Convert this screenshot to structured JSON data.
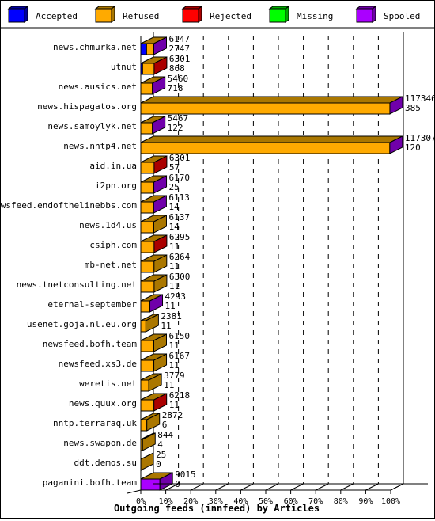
{
  "chart_data": {
    "type": "bar",
    "orientation": "horizontal",
    "stacked": true,
    "three_d": true,
    "title": "Outgoing feeds (innfeed) by Articles",
    "xlabel": "Outgoing feeds (innfeed) by Articles",
    "ylabel": "",
    "xlim_percent": [
      0,
      100
    ],
    "x_ticks": [
      "0%",
      "10%",
      "20%",
      "30%",
      "40%",
      "50%",
      "60%",
      "70%",
      "80%",
      "90%",
      "100%"
    ],
    "grid": "vertical dashed",
    "legend_position": "top",
    "legend": [
      {
        "name": "Accepted",
        "color": "#0000ff",
        "shade": "#0000a0"
      },
      {
        "name": "Refused",
        "color": "#ffaa00",
        "shade": "#aa7700"
      },
      {
        "name": "Rejected",
        "color": "#ff0000",
        "shade": "#aa0000"
      },
      {
        "name": "Missing",
        "color": "#00ff00",
        "shade": "#00aa00"
      },
      {
        "name": "Spooled",
        "color": "#aa00ff",
        "shade": "#7000aa"
      }
    ],
    "max_value": 117731,
    "categories": [
      "news.chmurka.net",
      "utnut",
      "news.ausics.net",
      "news.hispagatos.org",
      "news.samoylyk.net",
      "news.nntp4.net",
      "aid.in.ua",
      "i2pn.org",
      "newsfeed.endofthelinebbs.com",
      "news.1d4.us",
      "csiph.com",
      "mb-net.net",
      "news.tnetconsulting.net",
      "eternal-september",
      "usenet.goja.nl.eu.org",
      "newsfeed.bofh.team",
      "newsfeed.xs3.de",
      "weretis.net",
      "news.quux.org",
      "nntp.terraraq.uk",
      "news.swapon.de",
      "ddt.demos.su",
      "paganini.bofh.team"
    ],
    "rows": [
      {
        "label": "news.chmurka.net",
        "top": "6147",
        "bottom": "2747",
        "segments": {
          "Accepted": 2747,
          "Refused": 3400,
          "Spooled": 0
        },
        "side": "Spooled"
      },
      {
        "label": "utnut",
        "top": "6301",
        "bottom": "868",
        "segments": {
          "Accepted": 868,
          "Refused": 5433
        },
        "side": "Rejected"
      },
      {
        "label": "news.ausics.net",
        "top": "5460",
        "bottom": "718",
        "segments": {
          "Refused": 5460
        },
        "side": "Spooled"
      },
      {
        "label": "news.hispagatos.org",
        "top": "117346",
        "bottom": "385",
        "segments": {
          "Refused": 117346
        },
        "side": "Spooled"
      },
      {
        "label": "news.samoylyk.net",
        "top": "5467",
        "bottom": "122",
        "segments": {
          "Refused": 5467
        },
        "side": "Spooled"
      },
      {
        "label": "news.nntp4.net",
        "top": "117307",
        "bottom": "120",
        "segments": {
          "Refused": 117307
        },
        "side": "Spooled"
      },
      {
        "label": "aid.in.ua",
        "top": "6301",
        "bottom": "57",
        "segments": {
          "Refused": 6301
        },
        "side": "Rejected"
      },
      {
        "label": "i2pn.org",
        "top": "6170",
        "bottom": "25",
        "segments": {
          "Refused": 6170
        },
        "side": "Spooled"
      },
      {
        "label": "newsfeed.endofthelinebbs.com",
        "top": "6113",
        "bottom": "14",
        "segments": {
          "Refused": 6113
        },
        "side": "Spooled"
      },
      {
        "label": "news.1d4.us",
        "top": "6137",
        "bottom": "14",
        "segments": {
          "Refused": 6137
        },
        "side": "Refused"
      },
      {
        "label": "csiph.com",
        "top": "6295",
        "bottom": "11",
        "segments": {
          "Refused": 6295
        },
        "side": "Rejected"
      },
      {
        "label": "mb-net.net",
        "top": "6264",
        "bottom": "11",
        "segments": {
          "Refused": 6264
        },
        "side": "Refused"
      },
      {
        "label": "news.tnetconsulting.net",
        "top": "6300",
        "bottom": "11",
        "segments": {
          "Refused": 6300
        },
        "side": "Refused"
      },
      {
        "label": "eternal-september",
        "top": "4293",
        "bottom": "11",
        "segments": {
          "Refused": 4293
        },
        "side": "Spooled"
      },
      {
        "label": "usenet.goja.nl.eu.org",
        "top": "2381",
        "bottom": "11",
        "segments": {
          "Refused": 2381
        },
        "side": "Refused"
      },
      {
        "label": "newsfeed.bofh.team",
        "top": "6150",
        "bottom": "11",
        "segments": {
          "Refused": 6150
        },
        "side": "Refused"
      },
      {
        "label": "newsfeed.xs3.de",
        "top": "6167",
        "bottom": "11",
        "segments": {
          "Refused": 6167
        },
        "side": "Refused"
      },
      {
        "label": "weretis.net",
        "top": "3779",
        "bottom": "11",
        "segments": {
          "Refused": 3779
        },
        "side": "Refused"
      },
      {
        "label": "news.quux.org",
        "top": "6218",
        "bottom": "11",
        "segments": {
          "Refused": 6218
        },
        "side": "Rejected"
      },
      {
        "label": "nntp.terraraq.uk",
        "top": "2872",
        "bottom": "6",
        "segments": {
          "Refused": 2872
        },
        "side": "Refused"
      },
      {
        "label": "news.swapon.de",
        "top": "844",
        "bottom": "4",
        "segments": {
          "Refused": 844
        },
        "side": "Refused"
      },
      {
        "label": "ddt.demos.su",
        "top": "25",
        "bottom": "0",
        "segments": {
          "Refused": 25
        },
        "side": "Refused"
      },
      {
        "label": "paganini.bofh.team",
        "top": "9015",
        "bottom": "0",
        "segments": {
          "Spooled": 9015
        },
        "side": "Spooled"
      }
    ]
  }
}
